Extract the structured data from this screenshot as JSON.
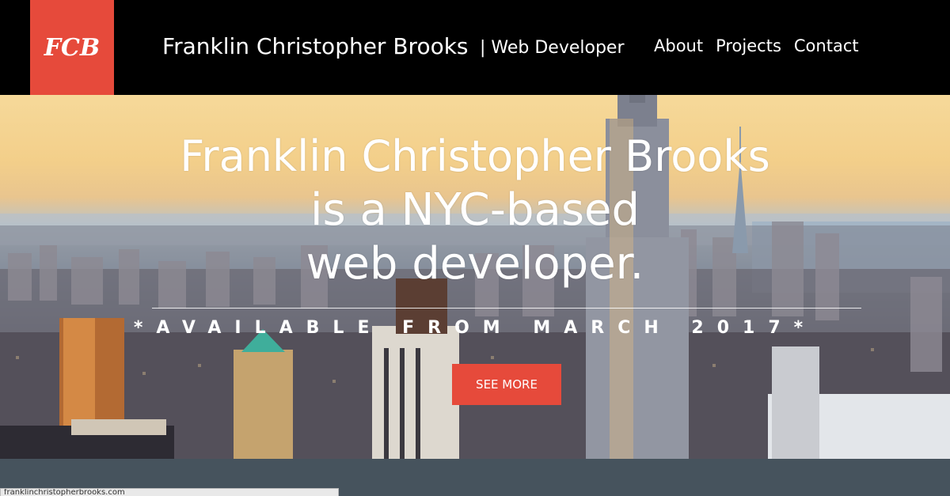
{
  "header": {
    "logo_text": "FCB",
    "site_name": "Franklin Christopher Brooks",
    "site_role": "| Web Developer",
    "nav": [
      "About",
      "Projects",
      "Contact"
    ]
  },
  "hero": {
    "line1": "Franklin Christopher Brooks",
    "line2": "is a NYC-based",
    "line3": "web developer.",
    "availability": "*AVAILABLE FROM MARCH 2017*",
    "cta_label": "SEE MORE"
  },
  "status_bar": {
    "url": "franklinchristopherbrooks.com"
  },
  "colors": {
    "accent": "#e64a3b",
    "header_bg": "#000000",
    "band": "#46535d"
  }
}
